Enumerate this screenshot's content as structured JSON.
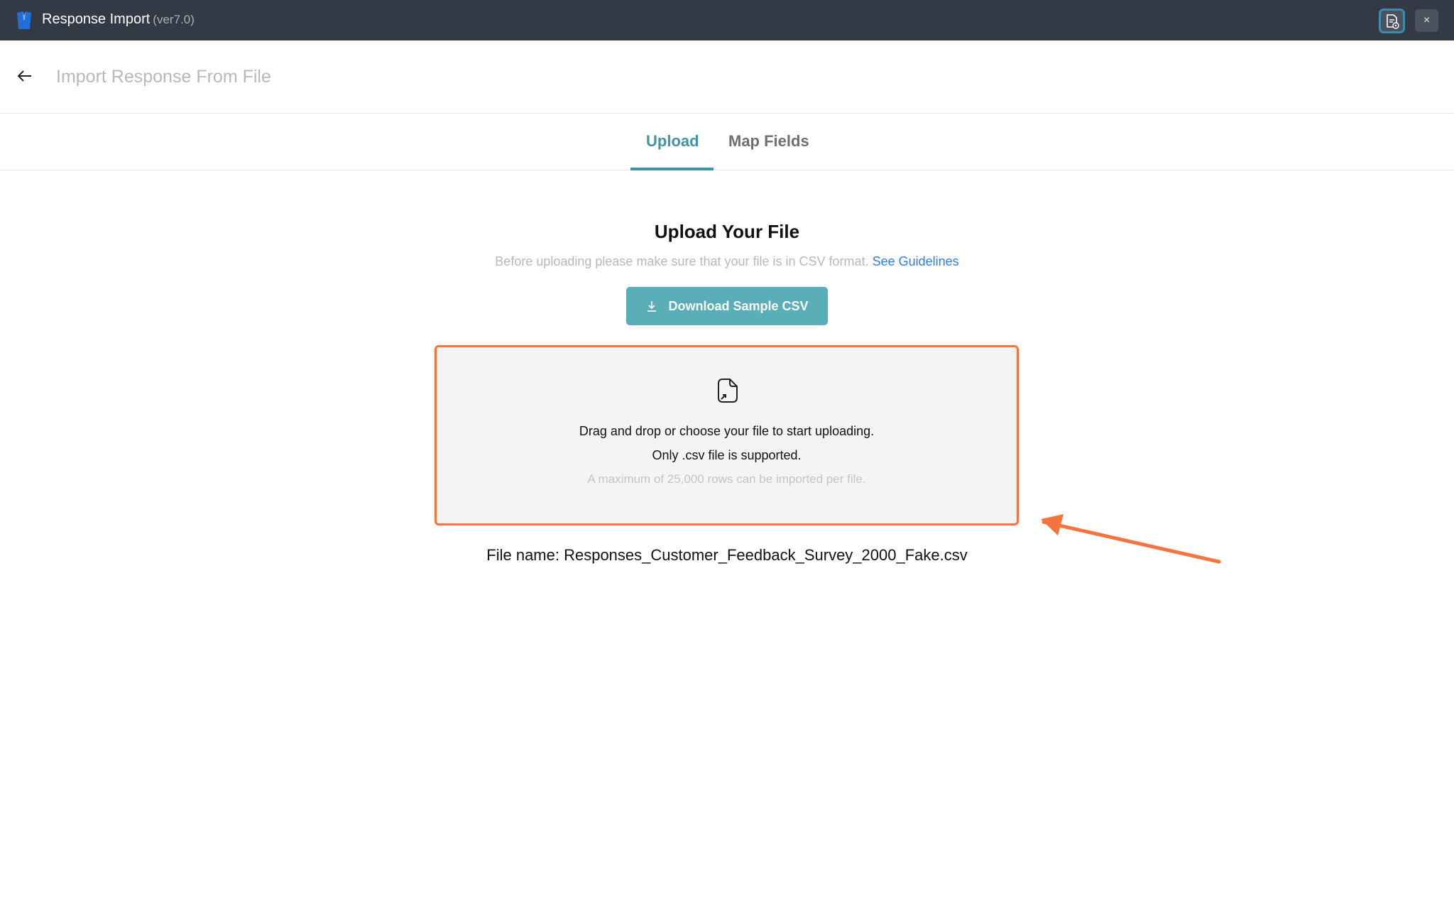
{
  "titlebar": {
    "app_name": "Response Import",
    "version": "(ver7.0)",
    "close_symbol": "×"
  },
  "header": {
    "title": "Import Response From File"
  },
  "tabs": [
    {
      "label": "Upload",
      "active": true
    },
    {
      "label": "Map Fields",
      "active": false
    }
  ],
  "upload": {
    "heading": "Upload Your File",
    "subtitle": "Before uploading please make sure that your file is in CSV format.",
    "guidelines_link": "See Guidelines",
    "download_button": "Download Sample CSV",
    "dropzone": {
      "line1": "Drag and drop or choose your file to start uploading.",
      "line2": "Only .csv file is supported.",
      "line3": "A maximum of 25,000 rows can be imported per file."
    },
    "file_name": "File name: Responses_Customer_Feedback_Survey_2000_Fake.csv"
  },
  "colors": {
    "titlebar": "#343a45",
    "accent": "#3f95a1",
    "button": "#5aaeb8",
    "dropzone_border": "#f2743f",
    "link": "#2d7ee0"
  },
  "icons": [
    "app-logo-icon",
    "doc-settings-icon",
    "close-icon",
    "back-arrow-icon",
    "download-icon",
    "file-import-icon",
    "annotation-arrow"
  ]
}
